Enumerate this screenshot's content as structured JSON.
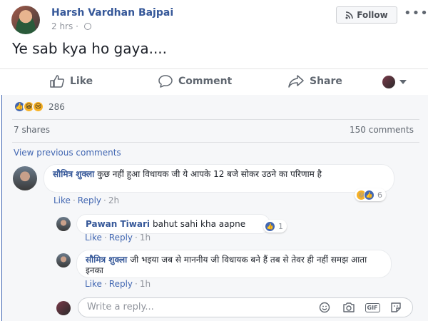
{
  "post": {
    "author": "Harsh Vardhan Bajpai",
    "time": "2 hrs",
    "follow_label": "Follow",
    "more": "•••",
    "text": "Ye sab kya ho gaya...."
  },
  "actions": {
    "like": "Like",
    "comment": "Comment",
    "share": "Share"
  },
  "stats": {
    "reactions_count": "286",
    "shares": "7 shares",
    "comments": "150 comments",
    "view_previous": "View previous comments"
  },
  "comments": [
    {
      "name": "सौमित्र शुक्ला",
      "text": "कुछ नहीं हुआ विधायक जी ये आपके 12 बजे सोकर उठने का परिणाम है",
      "like": "Like",
      "reply": "Reply",
      "time": "2h",
      "reaction_count": "6"
    },
    {
      "name": "Pawan Tiwari",
      "text": "bahut sahi kha aapne",
      "like": "Like",
      "reply": "Reply",
      "time": "1h",
      "reaction_count": "1"
    },
    {
      "name": "सौमित्र शुक्ला",
      "text": "जी भइया जब से माननीय जी विधायक बने हैं तब से तेवर ही नहीं समझ आता इनका",
      "like": "Like",
      "reply": "Reply",
      "time": "1h"
    }
  ],
  "reply_box": {
    "placeholder": "Write a reply...",
    "gif_label": "GIF"
  },
  "colors": {
    "link": "#365899",
    "accent": "#4267b2",
    "muted": "#90949c"
  }
}
